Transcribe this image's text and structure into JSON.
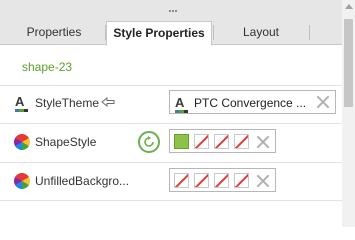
{
  "tabs": [
    {
      "label": "Properties",
      "active": false
    },
    {
      "label": "Style Properties",
      "active": true
    },
    {
      "label": "Layout",
      "active": false
    }
  ],
  "selected_widget": "shape-23",
  "rows": {
    "style_theme": {
      "label": "StyleTheme",
      "value": "PTC Convergence ..."
    },
    "shape_style": {
      "label": "ShapeStyle"
    },
    "unfilled_background": {
      "label": "UnfilledBackgro..."
    }
  },
  "colors": {
    "accent_green": "#5aa02c",
    "swatch_fill": "#8bc34a",
    "no_style_slash": "#e53935"
  },
  "icons": {
    "theme": "style-theme-icon",
    "palette": "color-palette-icon",
    "inherit": "back-arrow-icon",
    "reset": "reset-icon",
    "clear": "close-icon"
  }
}
